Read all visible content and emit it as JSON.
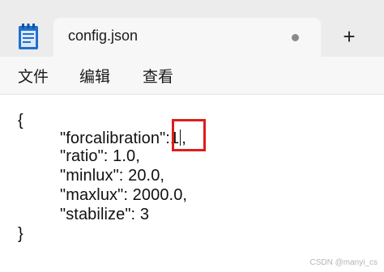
{
  "tab": {
    "title": "config.json",
    "unsaved_indicator": "•"
  },
  "titlebar": {
    "new_tab_label": "+"
  },
  "menu": {
    "items": [
      "文件",
      "编辑",
      "查看"
    ]
  },
  "editor": {
    "open_brace": "{",
    "line1_text": "\"forcalibration\":1",
    "line1_suffix": ",",
    "line2": "\"ratio\": 1.0,",
    "line3": "\"minlux\": 20.0,",
    "line4": "\"maxlux\": 2000.0,",
    "line5": "\"stabilize\": 3",
    "close_brace": "}"
  },
  "watermark": "CSDN @manyi_cs",
  "colors": {
    "highlight": "#e01c1c",
    "app_icon": "#1f6fd1"
  },
  "icons": {
    "app": "notepad-icon",
    "new_tab": "plus-icon",
    "unsaved": "dot-icon"
  }
}
